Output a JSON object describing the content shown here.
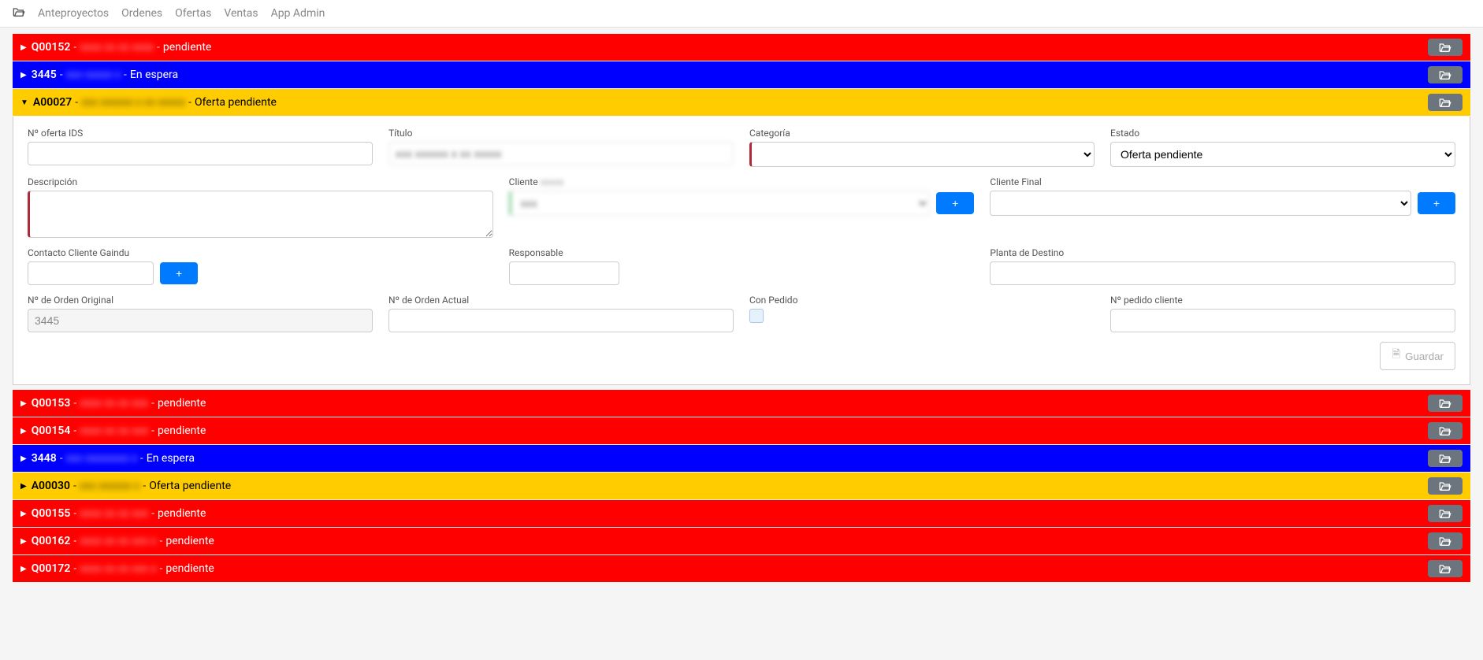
{
  "nav": {
    "items": [
      "Anteproyectos",
      "Ordenes",
      "Ofertas",
      "Ventas",
      "App Admin"
    ]
  },
  "rows": [
    {
      "color": "red",
      "expanded": false,
      "code": "Q00152",
      "hidden": "xxxx xx xx xxxx",
      "status": "pendiente"
    },
    {
      "color": "blue",
      "expanded": false,
      "code": "3445",
      "hidden": "xxx xxxxx x",
      "status": "En espera"
    },
    {
      "color": "yellow",
      "expanded": true,
      "code": "A00027",
      "hidden": "xxx xxxxxx x xx xxxxx",
      "status": "Oferta pendiente"
    },
    {
      "color": "red",
      "expanded": false,
      "code": "Q00153",
      "hidden": "xxxx xx xx xxx",
      "status": "pendiente"
    },
    {
      "color": "red",
      "expanded": false,
      "code": "Q00154",
      "hidden": "xxxx xx xx xxx",
      "status": "pendiente"
    },
    {
      "color": "blue",
      "expanded": false,
      "code": "3448",
      "hidden": "xxx xxxxxxxx x",
      "status": "En espera"
    },
    {
      "color": "yellow",
      "expanded": false,
      "code": "A00030",
      "hidden": "xxx xxxxxx x",
      "status": "Oferta pendiente"
    },
    {
      "color": "red",
      "expanded": false,
      "code": "Q00155",
      "hidden": "xxxx xx xx xxx",
      "status": "pendiente"
    },
    {
      "color": "red",
      "expanded": false,
      "code": "Q00162",
      "hidden": "xxxx xx xx xxx x",
      "status": "pendiente"
    },
    {
      "color": "red",
      "expanded": false,
      "code": "Q00172",
      "hidden": "xxxx xx xx xxx x",
      "status": "pendiente"
    }
  ],
  "form": {
    "labels": {
      "noferta": "Nº oferta IDS",
      "titulo": "Título",
      "categoria": "Categoría",
      "estado": "Estado",
      "descripcion": "Descripción",
      "cliente": "Cliente",
      "cliente_hidden": "xxxxx",
      "cliente_final": "Cliente Final",
      "contacto": "Contacto Cliente Gaindu",
      "responsable": "Responsable",
      "planta": "Planta de Destino",
      "norden_orig": "Nº de Orden Original",
      "norden_act": "Nº de Orden Actual",
      "con_pedido": "Con Pedido",
      "npedido": "Nº pedido cliente"
    },
    "values": {
      "noferta": "",
      "titulo_hidden": "xxx xxxxxx x xx xxxxx",
      "categoria": "",
      "estado": "Oferta pendiente",
      "descripcion": "",
      "cliente_hidden": "xxx",
      "cliente_final": "",
      "contacto": "",
      "responsable": "",
      "planta": "",
      "norden_orig": "3445",
      "norden_act": "",
      "npedido": ""
    },
    "save_label": "Guardar"
  }
}
